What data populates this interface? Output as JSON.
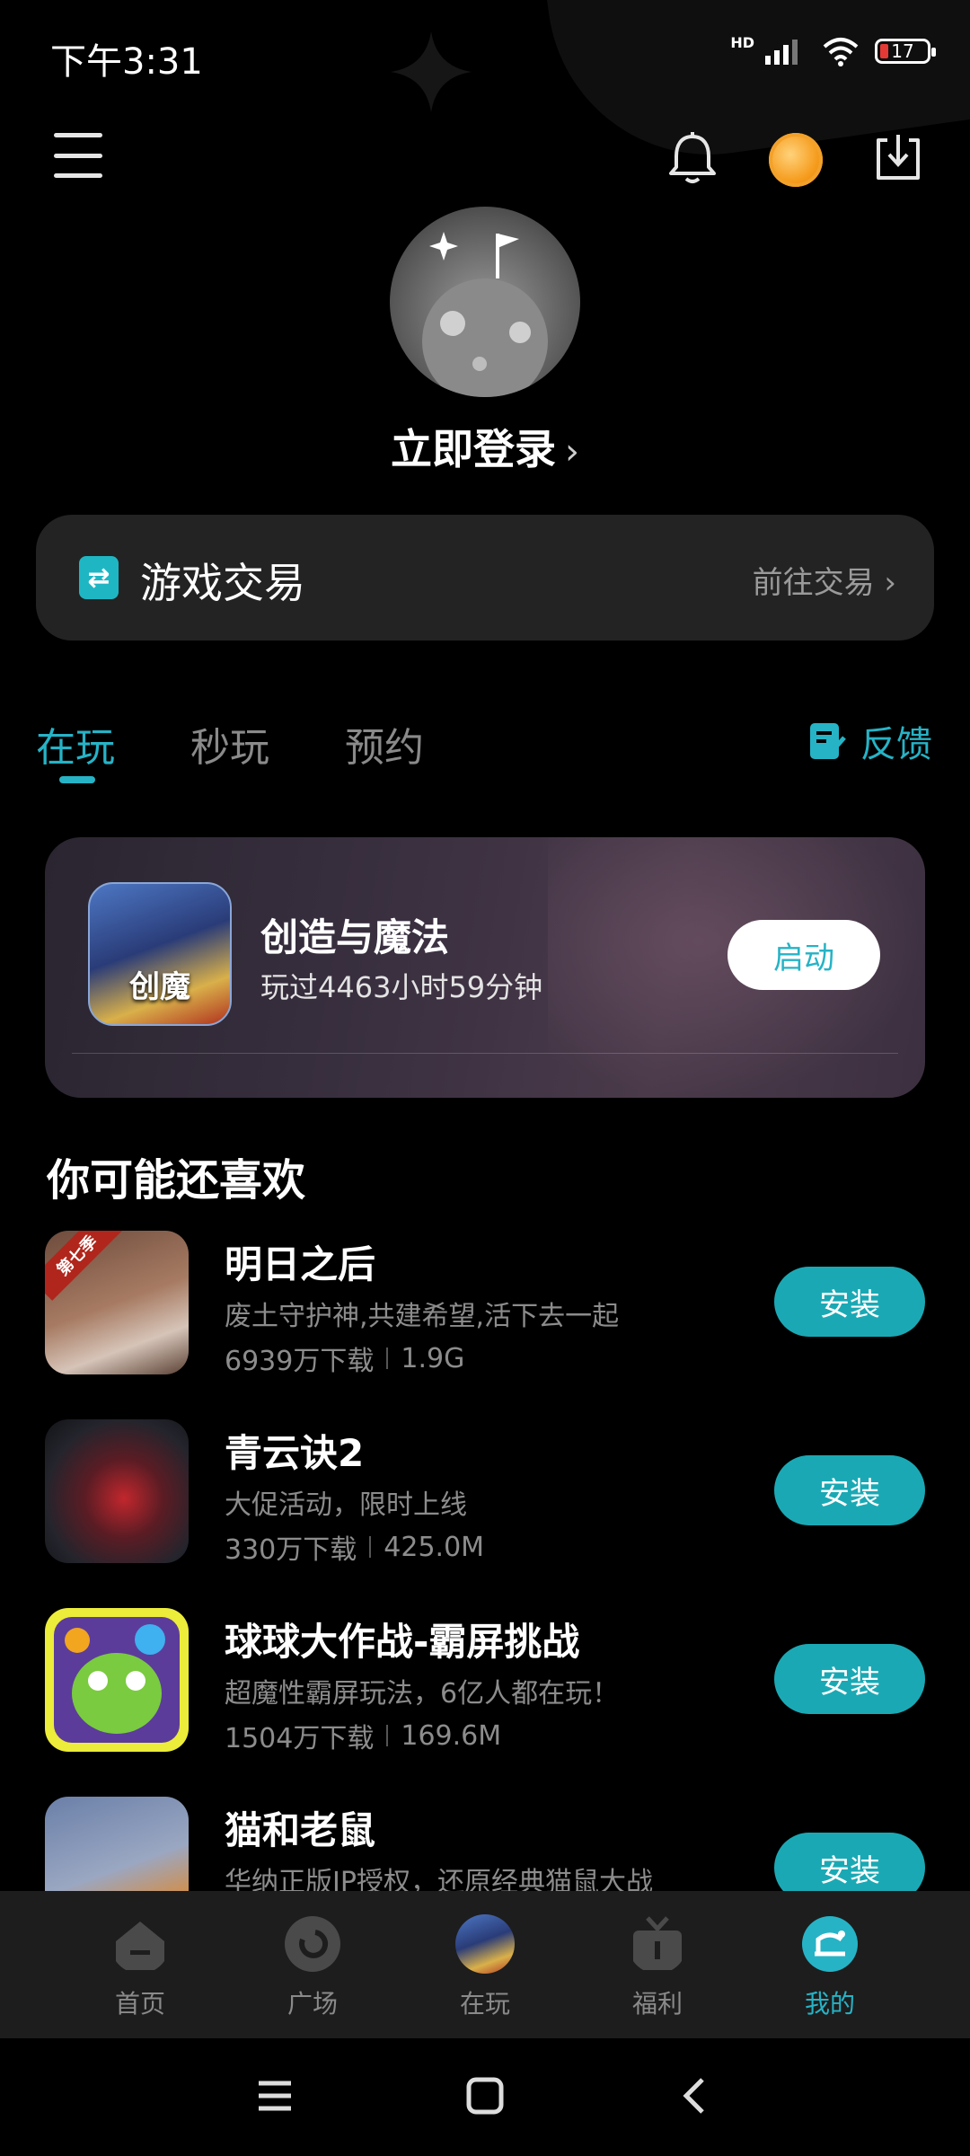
{
  "status": {
    "time": "下午3:31",
    "hd": "HD",
    "battery": "17"
  },
  "header": {
    "login_label": "立即登录",
    "chevron": "›"
  },
  "trade": {
    "title": "游戏交易",
    "link": "前往交易 ›",
    "icon": "swap-icon"
  },
  "tabs": [
    {
      "label": "在玩",
      "active": true
    },
    {
      "label": "秒玩",
      "active": false
    },
    {
      "label": "预约",
      "active": false
    }
  ],
  "feedback_label": "反馈",
  "playing": {
    "name": "创造与魔法",
    "playtime": "玩过4463小时59分钟",
    "icon_text": "创魔",
    "launch_label": "启动"
  },
  "recommend": {
    "title": "你可能还喜欢",
    "items": [
      {
        "name": "明日之后",
        "desc": "废土守护神,共建希望,活下去一起",
        "downloads": "6939万下载",
        "size": "1.9G",
        "badge": "第七季",
        "install": "安装"
      },
      {
        "name": "青云诀2",
        "desc": "大促活动，限时上线",
        "downloads": "330万下载",
        "size": "425.0M",
        "install": "安装"
      },
      {
        "name": "球球大作战-霸屏挑战",
        "desc": "超魔性霸屏玩法，6亿人都在玩！",
        "downloads": "1504万下载",
        "size": "169.6M",
        "install": "安装"
      },
      {
        "name": "猫和老鼠",
        "desc": "华纳正版IP授权，还原经典猫鼠大战",
        "install": "安装"
      }
    ]
  },
  "nav": [
    {
      "label": "首页",
      "icon": "home-icon",
      "active": false
    },
    {
      "label": "广场",
      "icon": "square-icon",
      "active": false
    },
    {
      "label": "在玩",
      "icon": "playing-icon",
      "active": false
    },
    {
      "label": "福利",
      "icon": "gift-icon",
      "active": false
    },
    {
      "label": "我的",
      "icon": "profile-icon",
      "active": true
    }
  ],
  "colors": {
    "accent": "#26b3c6",
    "install": "#1aa9b4",
    "background": "#000000",
    "card": "#232323"
  }
}
